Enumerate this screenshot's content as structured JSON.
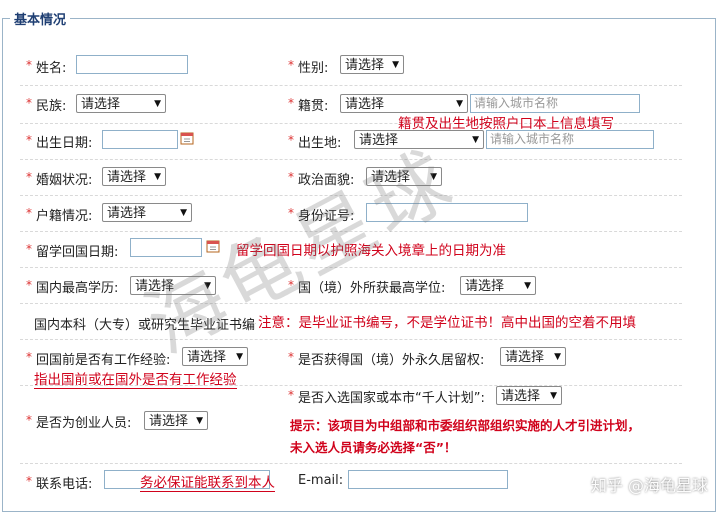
{
  "section_title": "基本情况",
  "required_mark": "*",
  "select_placeholder": "请选择",
  "city_placeholder": "请输入城市名称",
  "fields": {
    "name": "姓名:",
    "gender": "性别:",
    "ethnicity": "民族:",
    "native_place": "籍贯:",
    "birth_date": "出生日期:",
    "birth_place": "出生地:",
    "marital_status": "婚姻状况:",
    "political_status": "政治面貌:",
    "household": "户籍情况:",
    "id_number": "身份证号:",
    "return_date": "留学回国日期:",
    "domestic_degree": "国内最高学历:",
    "foreign_degree": "国（境）外所获最高学位:",
    "domestic_cert": "国内本科（大专）或研究生毕业证书编号:",
    "work_before": "回国前是否有工作经验:",
    "permanent_residency": "是否获得国（境）外永久居留权:",
    "thousand_talents": "是否入选国家或本市“千人计划”:",
    "entrepreneur": "是否为创业人员:",
    "phone": "联系电话:",
    "email": "E-mail:"
  },
  "notes": {
    "native_place": "籍贯及出生地按照户口本上信息填写",
    "return_date": "留学回国日期以护照海关入境章上的日期为准",
    "cert": "注意：是毕业证书编号，不是学位证书！高中出国的空着不用填",
    "work": "指出国前或在国外是否有工作经验",
    "phone": "务必保证能联系到本人",
    "tip_line1": "提示：该项目为中组部和市委组织部组织实施的人才引进计划，",
    "tip_line2": "未入选人员请务必选择“否”！"
  },
  "watermark": "海龟星球",
  "footer_watermark": "知乎 @海龟星球",
  "colors": {
    "note_red": "#d0021b",
    "border_blue": "#9bb4c8",
    "legend_blue": "#1f3f73"
  }
}
